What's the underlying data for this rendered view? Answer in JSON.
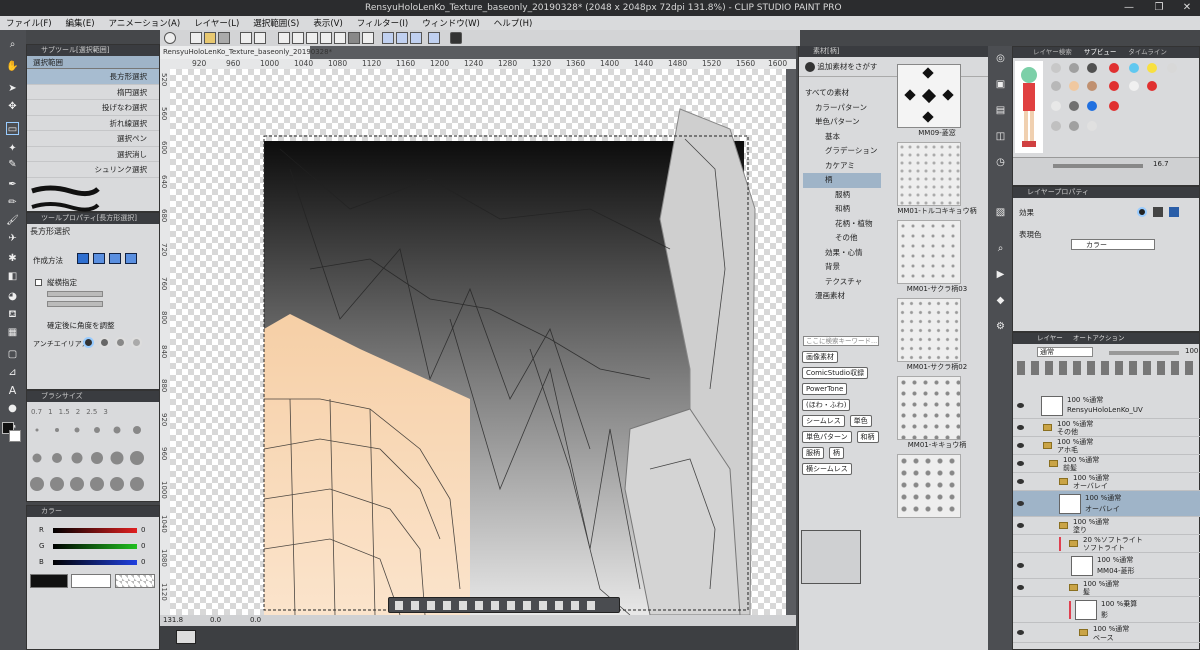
{
  "window": {
    "title": "RensyuHoloLenKo_Texture_baseonly_20190328* (2048 x 2048px 72dpi 131.8%)  - CLIP STUDIO PAINT PRO",
    "controls": [
      "—",
      "❐",
      "✕"
    ]
  },
  "menu": [
    "ファイル(F)",
    "編集(E)",
    "アニメーション(A)",
    "レイヤー(L)",
    "選択範囲(S)",
    "表示(V)",
    "フィルター(I)",
    "ウィンドウ(W)",
    "ヘルプ(H)"
  ],
  "subtool": {
    "header": "サブツール[選択範囲]",
    "group": "選択範囲",
    "items": [
      "長方形選択",
      "楕円選択",
      "投げなわ選択",
      "折れ線選択",
      "選択ペン",
      "選択消し",
      "シュリンク選択"
    ],
    "selected_index": 0
  },
  "tool_property": {
    "header": "ツールプロパティ[長方形選択]",
    "tool_name": "長方形選択",
    "creation_method_label": "作成方法",
    "aspect_label": "縦横指定",
    "adjust_label": "確定後に角度を調整",
    "antialias_label": "アンチエイリアス"
  },
  "brush_size": {
    "header": "ブラシサイズ",
    "sizes": [
      "0.7",
      "1",
      "1.5",
      "2",
      "2.5",
      "3"
    ]
  },
  "color_panel": {
    "header": "カラー",
    "channels": [
      {
        "label": "R",
        "value": "0",
        "color": "#d42020"
      },
      {
        "label": "G",
        "value": "0",
        "color": "#20b020"
      },
      {
        "label": "B",
        "value": "0",
        "color": "#2040d0"
      }
    ]
  },
  "document": {
    "tab": "RensyuHoloLenKo_Texture_baseonly_20190328*",
    "ruler_h": [
      "920",
      "960",
      "1000",
      "1040",
      "1080",
      "1120",
      "1160",
      "1200",
      "1240",
      "1280",
      "1320",
      "1360",
      "1400",
      "1440",
      "1480",
      "1520",
      "1560",
      "1600"
    ],
    "ruler_v": [
      "520",
      "560",
      "600",
      "640",
      "680",
      "720",
      "760",
      "800",
      "840",
      "880",
      "920",
      "960",
      "1000",
      "1040",
      "1080",
      "1120"
    ],
    "zoom": "131.8",
    "status_values": [
      "0.0",
      "0.0"
    ]
  },
  "material": {
    "header": "素材[柄]",
    "add_button": "追加素材をさがす",
    "tree": [
      "すべての素材",
      "カラーパターン",
      "単色パターン",
      "基本",
      "グラデーション",
      "カケアミ",
      "柄",
      "服柄",
      "和柄",
      "花柄・植物",
      "その他",
      "効果・心情",
      "背景",
      "テクスチャ",
      "漫画素材"
    ],
    "tree_selected": "柄",
    "search_placeholder": "ここに検索キーワード...",
    "tags": [
      "画像素材",
      "ComicStudio収録",
      "PowerTone",
      "(ほわ・ふわ)",
      "シームレス",
      "単色",
      "単色パターン",
      "和柄",
      "服柄",
      "柄",
      "横シームレス"
    ],
    "thumbs": [
      "MM09-菱窓",
      "MM01-トルコキキョウ柄",
      "MM01-サクラ柄03",
      "MM01-サクラ柄02",
      "MM01-キキョウ柄"
    ]
  },
  "subview": {
    "tabs": [
      "レイヤー検索",
      "サブビュー",
      "タイムライン"
    ],
    "zoom_value": "16.7",
    "palette": [
      "#c8c8c8",
      "#a0a0a0",
      "#505050",
      "#e03030",
      "#60c8f0",
      "#f8e040",
      "#d8d8d8",
      "#b8b8b8",
      "#f0c8a0",
      "#c09070",
      "#e03030",
      "#f0f0f0",
      "#e03030",
      "#e8e8e8",
      "#707070",
      "#2070e0",
      "#e03030",
      "#c0c0c0",
      "#a0a0a0",
      "#e0e0e0"
    ]
  },
  "layer_property": {
    "header": "レイヤープロパティ",
    "effect_label": "効果",
    "expression_label": "表現色",
    "expression_value": "カラー"
  },
  "layers": {
    "tabs": [
      "レイヤー",
      "オートアクション"
    ],
    "blend": "通常",
    "opacity": "100",
    "rows": [
      {
        "top": "100 %通常",
        "name": "RensyuHoloLenKo_UV",
        "kind": "layer",
        "indent": 0
      },
      {
        "top": "100 %通常",
        "name": "その他",
        "kind": "folder",
        "indent": 0
      },
      {
        "top": "100 %通常",
        "name": "アホ毛",
        "kind": "folder",
        "indent": 0
      },
      {
        "top": "100 %通常",
        "name": "前髪",
        "kind": "folder",
        "indent": 0
      },
      {
        "top": "100 %通常",
        "name": "オーバレイ",
        "kind": "folder",
        "indent": 1
      },
      {
        "top": "100 %通常",
        "name": "オーバレイ",
        "kind": "layer",
        "indent": 2,
        "selected": true
      },
      {
        "top": "100 %通常",
        "name": "塗り",
        "kind": "folder",
        "indent": 1
      },
      {
        "top": "20 %ソフトライト",
        "name": "ソフトライト",
        "kind": "folder",
        "indent": 2
      },
      {
        "top": "100 %通常",
        "name": "MM04-菱形",
        "kind": "layer",
        "indent": 2
      },
      {
        "top": "100 %通常",
        "name": "髪",
        "kind": "folder",
        "indent": 2
      },
      {
        "top": "100 %乗算",
        "name": "影",
        "kind": "layer",
        "indent": 3
      },
      {
        "top": "100 %通常",
        "name": "ベース",
        "kind": "folder",
        "indent": 3
      }
    ]
  }
}
